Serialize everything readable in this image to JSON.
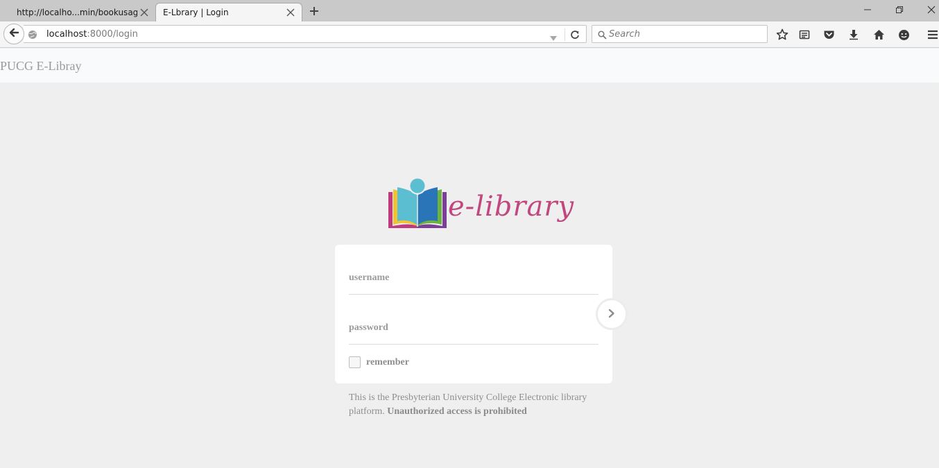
{
  "browser": {
    "tabs": [
      {
        "title": "http://localho...min/bookusage",
        "active": false
      },
      {
        "title": "E-Lbrary | Login",
        "active": true
      }
    ],
    "url": {
      "host": "localhost",
      "rest": ":8000/login"
    },
    "search": {
      "placeholder": "Search"
    },
    "icons": [
      "back-arrow-icon",
      "globe-icon",
      "dropdown-icon",
      "reload-icon",
      "search-icon",
      "bookmark-star-icon",
      "reading-list-icon",
      "pocket-icon",
      "download-icon",
      "home-icon",
      "chat-icon",
      "menu-icon",
      "minimize-icon",
      "restore-icon",
      "close-window-icon"
    ]
  },
  "site": {
    "brand": "PUCG E-Libray",
    "logo_text": "e-library"
  },
  "login": {
    "username_placeholder": "username",
    "password_placeholder": "password",
    "remember_label": "remember",
    "submit_icon": "chevron-right-icon"
  },
  "notice": {
    "text": "This is the Presbyterian University College Electronic library platform.",
    "bold": "Unauthorized access is prohibited"
  },
  "colors": {
    "page_bg": "#efefef",
    "logo_pink": "#c0487e",
    "muted_text": "#8e8e8e"
  }
}
